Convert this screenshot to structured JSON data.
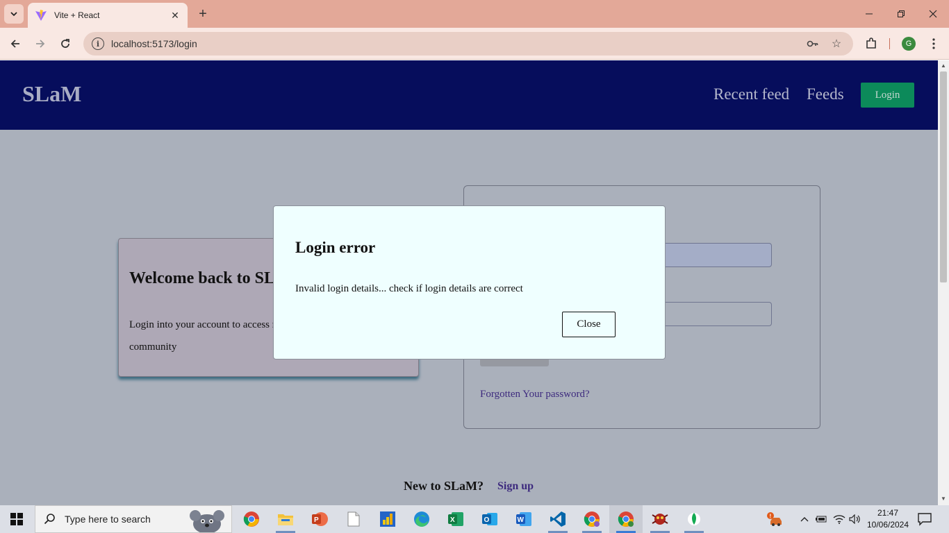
{
  "browser": {
    "tab_title": "Vite + React",
    "url": "localhost:5173/login",
    "profile_initial": "G"
  },
  "navbar": {
    "brand": "SLaM",
    "links": [
      "Recent feed",
      "Feeds"
    ],
    "login_label": "Login"
  },
  "welcome": {
    "title": "Welcome back to SLaM",
    "text": "Login into your account to access recent updates in the SLaM community"
  },
  "login_form": {
    "forgot_link": "Forgotten Your password?"
  },
  "signup": {
    "prompt": "New to SLaM?",
    "link": "Sign up"
  },
  "modal": {
    "title": "Login error",
    "message": "Invalid login details... check if login details are correct",
    "close_label": "Close"
  },
  "taskbar": {
    "search_placeholder": "Type here to search",
    "apps": [
      "chrome-icon",
      "file-explorer-icon",
      "powerpoint-icon",
      "notepad-icon",
      "power-bi-icon",
      "edge-icon",
      "excel-icon",
      "outlook-icon",
      "word-icon",
      "vscode-icon",
      "chrome-profile-icon",
      "chrome-active-icon",
      "app-bug-icon",
      "mongodb-icon"
    ],
    "time": "21:47",
    "date": "10/06/2024"
  },
  "colors": {
    "navbar_bg": "#060d5c",
    "page_bg": "#aab0bb",
    "login_button": "#0c8a5a",
    "modal_bg": "#efffff",
    "chrome_frame": "#e3a898"
  }
}
